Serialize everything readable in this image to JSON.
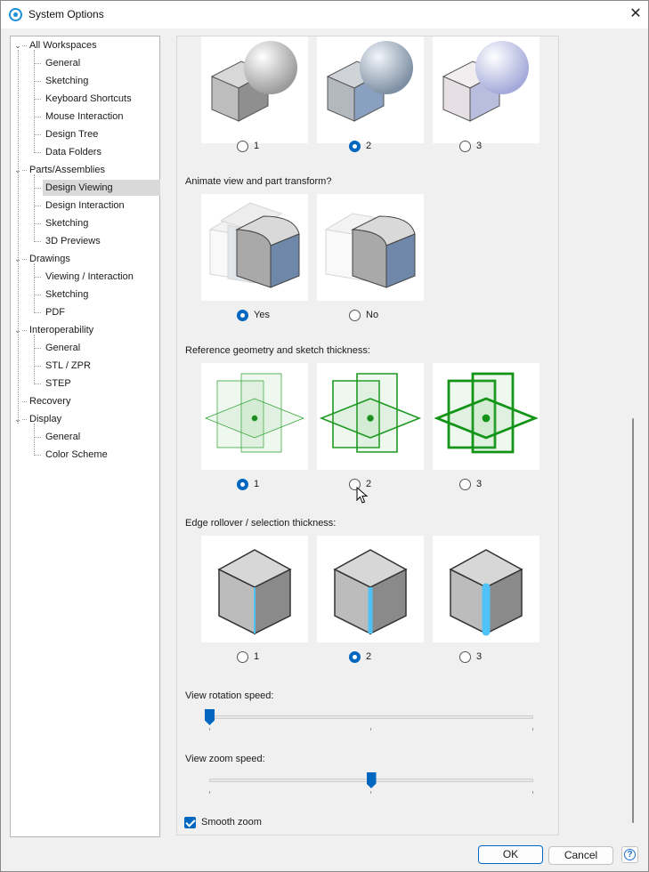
{
  "window": {
    "title": "System Options"
  },
  "tree": [
    {
      "label": "All Workspaces",
      "level": 0,
      "expanded": true
    },
    {
      "label": "General",
      "level": 1
    },
    {
      "label": "Sketching",
      "level": 1
    },
    {
      "label": "Keyboard Shortcuts",
      "level": 1
    },
    {
      "label": "Mouse Interaction",
      "level": 1
    },
    {
      "label": "Design Tree",
      "level": 1
    },
    {
      "label": "Data Folders",
      "level": 1
    },
    {
      "label": "Parts/Assemblies",
      "level": 0,
      "expanded": true
    },
    {
      "label": "Design Viewing",
      "level": 1,
      "selected": true
    },
    {
      "label": "Design Interaction",
      "level": 1
    },
    {
      "label": "Sketching",
      "level": 1
    },
    {
      "label": "3D Previews",
      "level": 1
    },
    {
      "label": "Drawings",
      "level": 0,
      "expanded": true
    },
    {
      "label": "Viewing / Interaction",
      "level": 1
    },
    {
      "label": "Sketching",
      "level": 1
    },
    {
      "label": "PDF",
      "level": 1
    },
    {
      "label": "Interoperability",
      "level": 0,
      "expanded": true
    },
    {
      "label": "General",
      "level": 1
    },
    {
      "label": "STL / ZPR",
      "level": 1
    },
    {
      "label": "STEP",
      "level": 1
    },
    {
      "label": "Recovery",
      "level": 0
    },
    {
      "label": "Display",
      "level": 0,
      "expanded": true
    },
    {
      "label": "General",
      "level": 1
    },
    {
      "label": "Color Scheme",
      "level": 1
    }
  ],
  "shading": {
    "options": [
      "1",
      "2",
      "3"
    ],
    "selected": "2"
  },
  "animate": {
    "label": "Animate view and part transform?",
    "options": [
      "Yes",
      "No"
    ],
    "selected": "Yes"
  },
  "reference": {
    "label": "Reference geometry and sketch thickness:",
    "options": [
      "1",
      "2",
      "3"
    ],
    "selected": "1"
  },
  "edge": {
    "label": "Edge rollover / selection thickness:",
    "options": [
      "1",
      "2",
      "3"
    ],
    "selected": "2"
  },
  "rotation": {
    "label": "View rotation speed:",
    "level": 0.0
  },
  "zoom": {
    "label": "View zoom speed:",
    "level": 0.5
  },
  "smooth": {
    "label": "Smooth zoom",
    "checked": true
  },
  "colors": {
    "accent": "#0067c0",
    "green": "#1fa02a",
    "highlight": "#4fc3f7"
  },
  "buttons": {
    "ok": "OK",
    "cancel": "Cancel",
    "help": "?"
  }
}
